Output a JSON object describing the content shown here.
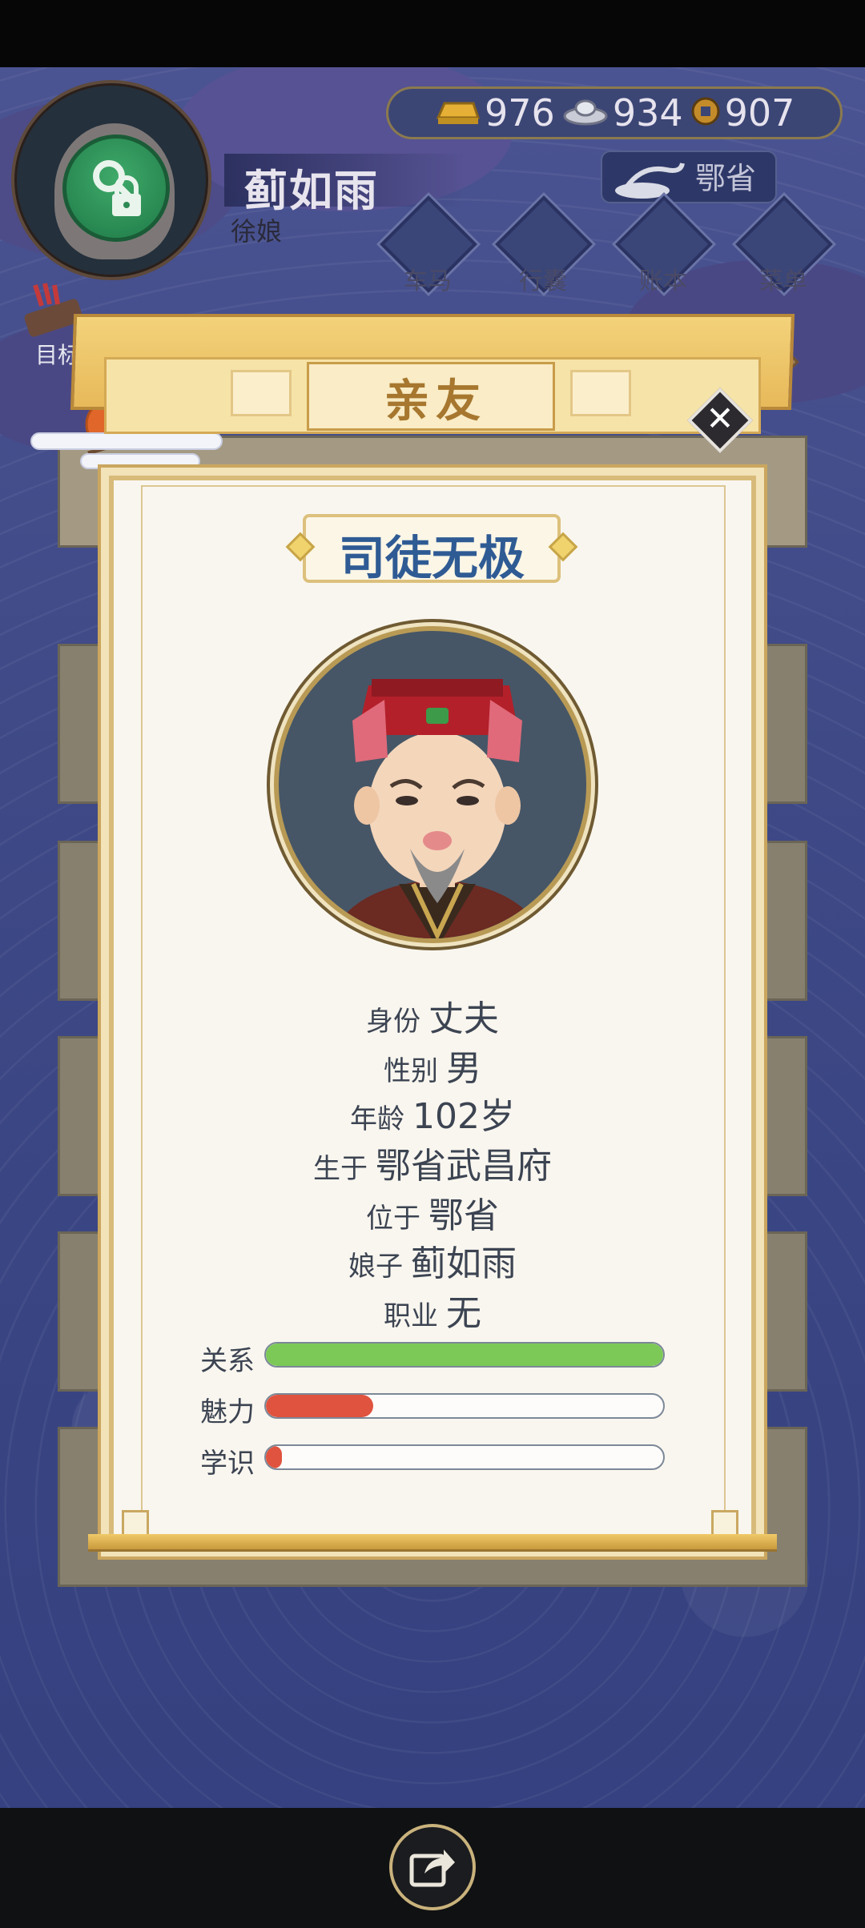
{
  "player": {
    "name": "蓟如雨",
    "title": "徐娘"
  },
  "currency": {
    "gold": "976",
    "silver": "934",
    "coin": "907"
  },
  "region": "鄂省",
  "menu": [
    {
      "label": "车马",
      "icon": "carriage-icon"
    },
    {
      "label": "行囊",
      "icon": "bag-icon"
    },
    {
      "label": "账本",
      "icon": "ledger-icon"
    },
    {
      "label": "菜单",
      "icon": "more-icon"
    }
  ],
  "goal_label": "目标",
  "background_panel_title": "亲友",
  "dialog": {
    "title": "亲友",
    "character_name": "司徒无极",
    "info": [
      {
        "label": "身份",
        "value": "丈夫"
      },
      {
        "label": "性别",
        "value": "男"
      },
      {
        "label": "年龄",
        "value": "102岁"
      },
      {
        "label": "生于",
        "value": "鄂省武昌府"
      },
      {
        "label": "位于",
        "value": "鄂省"
      },
      {
        "label": "娘子",
        "value": "蓟如雨"
      },
      {
        "label": "职业",
        "value": "无"
      }
    ],
    "stats": [
      {
        "label": "关系",
        "fraction": 1.0,
        "color": "#7cc957"
      },
      {
        "label": "魅力",
        "fraction": 0.27,
        "color": "#e0533e"
      },
      {
        "label": "学识",
        "fraction": 0.04,
        "color": "#e0533e"
      }
    ]
  }
}
